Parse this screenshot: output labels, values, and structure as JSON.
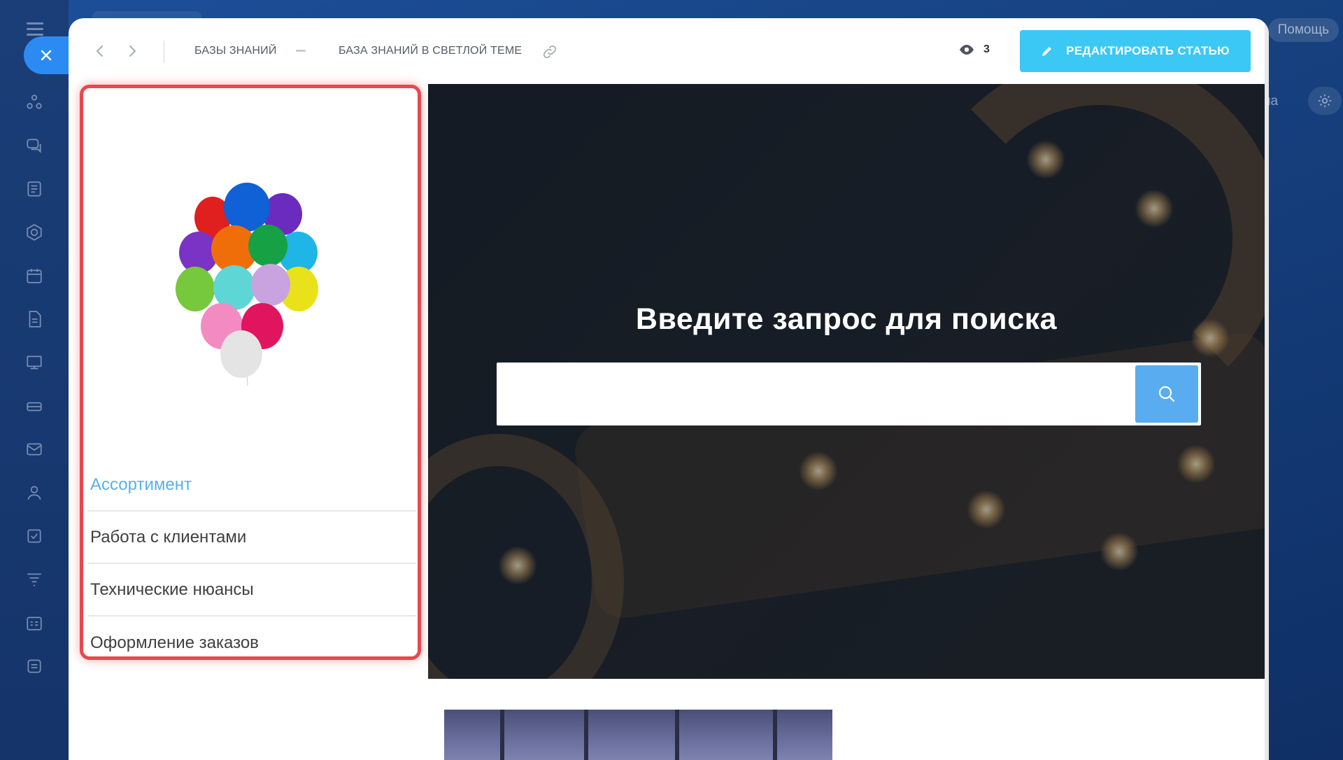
{
  "header": {
    "breadcrumbs": [
      "Базы знаний",
      "База знаний в светлой теме"
    ],
    "views_count": "3",
    "edit_button_label": "Редактировать статью"
  },
  "background": {
    "help_label": "Помощь",
    "partial_label": "на"
  },
  "menu": {
    "items": [
      {
        "label": "Ассортимент",
        "active": true
      },
      {
        "label": "Работа с клиентами",
        "active": false
      },
      {
        "label": "Технические нюансы",
        "active": false
      },
      {
        "label": "Оформление заказов",
        "active": false
      }
    ]
  },
  "hero": {
    "title": "Введите запрос для поиска",
    "search_placeholder": ""
  },
  "colors": {
    "accent": "#3bc8f5",
    "search_button": "#5aacf0",
    "highlight_outline": "#e8484e",
    "active_menu": "#58b1e8"
  },
  "icons": [
    "close-icon",
    "back-arrow-icon",
    "forward-arrow-icon",
    "link-icon",
    "eye-icon",
    "pencil-icon",
    "search-icon",
    "gear-icon"
  ]
}
